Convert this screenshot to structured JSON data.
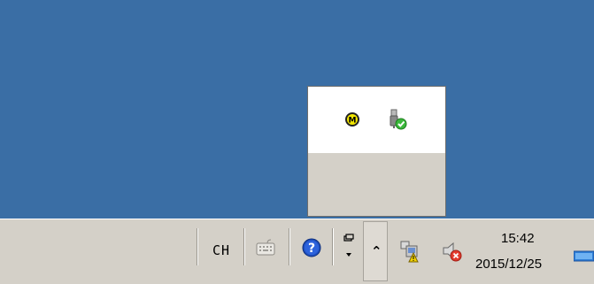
{
  "desktop": {
    "background": "#3a6ea5"
  },
  "overflow_popup": {
    "icons": [
      "m-circle-icon",
      "usb-safely-remove-icon"
    ]
  },
  "taskbar": {
    "language": "CH",
    "icons": [
      "keyboard-icon",
      "help-icon",
      "language-options-icon",
      "show-hidden-icons-chevron",
      "network-warning-icon",
      "volume-muted-icon",
      "show-desktop-icon"
    ],
    "clock": {
      "time": "15:42",
      "date": "2015/12/25"
    }
  }
}
